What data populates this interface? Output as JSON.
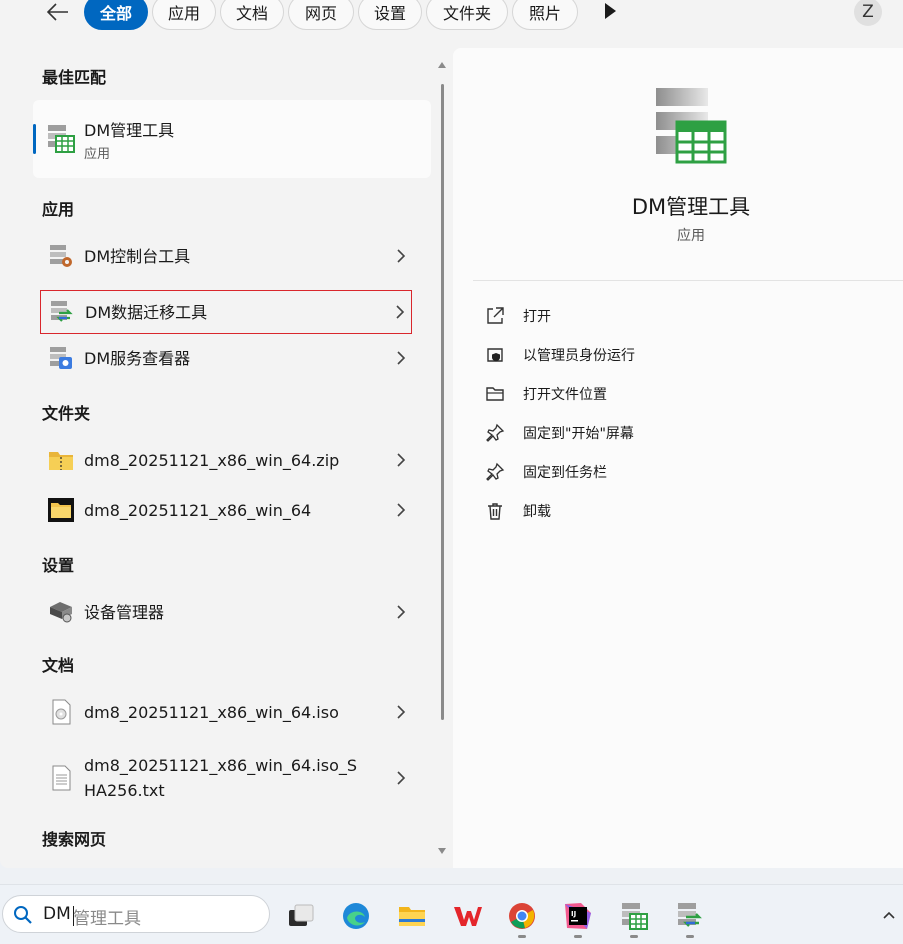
{
  "filters": {
    "chips": [
      {
        "label": "全部",
        "active": true
      },
      {
        "label": "应用",
        "active": false
      },
      {
        "label": "文档",
        "active": false
      },
      {
        "label": "网页",
        "active": false
      },
      {
        "label": "设置",
        "active": false
      },
      {
        "label": "文件夹",
        "active": false
      },
      {
        "label": "照片",
        "active": false
      }
    ],
    "user_initial": "Z"
  },
  "best_match": {
    "heading": "最佳匹配",
    "title": "DM管理工具",
    "subtitle": "应用"
  },
  "sections": {
    "apps": "应用",
    "folders": "文件夹",
    "settings": "设置",
    "documents": "文档",
    "web": "搜索网页"
  },
  "apps": [
    {
      "label": "DM控制台工具",
      "icon": "dm-console-icon"
    },
    {
      "label": "DM数据迁移工具",
      "icon": "dm-migration-icon",
      "highlighted": true
    },
    {
      "label": "DM服务查看器",
      "icon": "dm-service-icon"
    }
  ],
  "folders": [
    {
      "label": "dm8_20251121_x86_win_64.zip",
      "icon": "zip-folder-icon"
    },
    {
      "label": "dm8_20251121_x86_win_64",
      "icon": "folder-icon"
    }
  ],
  "settings": [
    {
      "label": "设备管理器",
      "icon": "device-manager-icon"
    }
  ],
  "documents": [
    {
      "label": "dm8_20251121_x86_win_64.iso",
      "icon": "disc-image-icon"
    },
    {
      "label": "dm8_20251121_x86_win_64.iso_S\nHA256.txt",
      "icon": "text-file-icon"
    }
  ],
  "detail": {
    "title": "DM管理工具",
    "kind": "应用",
    "actions": [
      {
        "label": "打开",
        "icon": "open-external-icon"
      },
      {
        "label": "以管理员身份运行",
        "icon": "admin-shield-icon"
      },
      {
        "label": "打开文件位置",
        "icon": "folder-open-icon"
      },
      {
        "label": "固定到\"开始\"屏幕",
        "icon": "pin-icon"
      },
      {
        "label": "固定到任务栏",
        "icon": "pin-icon"
      },
      {
        "label": "卸载",
        "icon": "trash-icon"
      }
    ]
  },
  "taskbar": {
    "search_typed": "DM",
    "search_hint": "管理工具"
  },
  "colors": {
    "accent": "#0067c0",
    "highlight_border": "#d9262c",
    "dm_green": "#2ea043"
  }
}
